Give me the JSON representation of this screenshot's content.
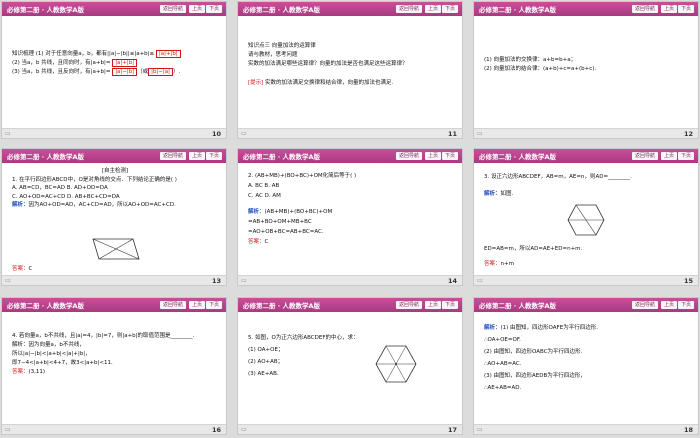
{
  "header": {
    "title": "必修第二册 · 人教数学A版",
    "nav_button": "返回导航",
    "prev_button": "上页",
    "next_button": "下页"
  },
  "colors": {
    "header": "#b8448b",
    "answer_red": "#d01818",
    "analysis_blue": "#2050c0"
  },
  "slides": [
    {
      "page": "10",
      "lines": [
        {
          "text": "知识梳理  (1) 对于任意向量a，b，都有||a|−|b||≤|a+b|≤",
          "box": "|a|+|b|"
        },
        {
          "text": "(2) 当a，b 共线，且同向时，有|a+b|=",
          "box": "|a|+|b|"
        },
        {
          "text": "(3) 当a，b 共线，且反向时，有|a+b|=",
          "box": "|a|−|b|",
          "tail": "（或",
          "box2": "|b|−|a|",
          "tail2": "）."
        }
      ]
    },
    {
      "page": "11",
      "lines": [
        "知识点三  向量加法的运算律",
        "请与教材，思考问题",
        "实数的加法满足哪些运算律？向量的加法是否也满足这些运算律？"
      ],
      "hint_label": "[提示]",
      "hint_text": "实数的加法满足交换律和结合律，向量的加法也满足."
    },
    {
      "page": "12",
      "lines": [
        "(1) 向量加法的交换律：a+b=b+a；",
        "(2) 向量加法的结合律：(a+b)+c=a+(b+c)."
      ]
    },
    {
      "page": "13",
      "heading": "[自主检测]",
      "lines": [
        "1. 在平行四边形ABCD中，O是对角线的交点．下列结论正确的是(    )",
        "A. AB=CD，BC=AD          B. AD+OD=DA",
        "C. AO+OD=AC+CD          D. AB+BC+CD=DA"
      ],
      "analysis_label": "解析：",
      "analysis_text": "因为AO+OD=AD，AC+CD=AD，所以AO+OD=AC+CD.",
      "answer_label": "答案：",
      "answer_value": "C"
    },
    {
      "page": "14",
      "lines": [
        "2. (AB+MB)+(BO+BC)+OM化简后等于(    )",
        "A. BC                              B. AB",
        "C. AC                              D. AM"
      ],
      "analysis_label": "解析：",
      "analysis_lines": [
        "(AB+MB)+(BO+BC)+OM",
        "=AB+BO+OM+MB+BC",
        "=AO+OB+BC=AB+BC=AC."
      ],
      "answer_label": "答案：",
      "answer_value": "C"
    },
    {
      "page": "15",
      "lines": [
        "3. 设正六边形ABCDEF，AB=m，AE=n，则AD=________."
      ],
      "analysis_label": "解析：",
      "analysis_text": "如图.",
      "after_fig": "ED=AB=m，所以AD=AE+ED=n+m.",
      "answer_label": "答案：",
      "answer_value": "n+m"
    },
    {
      "page": "16",
      "lines": [
        "4. 若向量a，b不共线，且|a|=4，|b|=7，则|a+b|的取值范围是________.",
        "解析：因为向量a，b不共线，",
        "所以|a|−|b|<|a+b|<|a|+|b|，",
        "即7−4<|a+b|<4+7，故3<|a+b|<11."
      ],
      "answer_label": "答案：",
      "answer_value": "(3,11)"
    },
    {
      "page": "17",
      "lines": [
        "5. 如图，O为正六边形ABCDEF的中心，求：",
        "(1) OA+OE；",
        "(2) AO+AB；",
        "(3) AE+AB."
      ]
    },
    {
      "page": "18",
      "analysis_label": "解析：",
      "lines": [
        "(1) 由图知，四边形OAFE为平行四边形.",
        "∴OA+OE=OF.",
        "(2) 由图知，四边形OABC为平行四边形.",
        "∴AO+AB=AC.",
        "(3) 由图知，四边形AEDB为平行四边形，",
        "∴AE+AB=AD."
      ]
    }
  ]
}
